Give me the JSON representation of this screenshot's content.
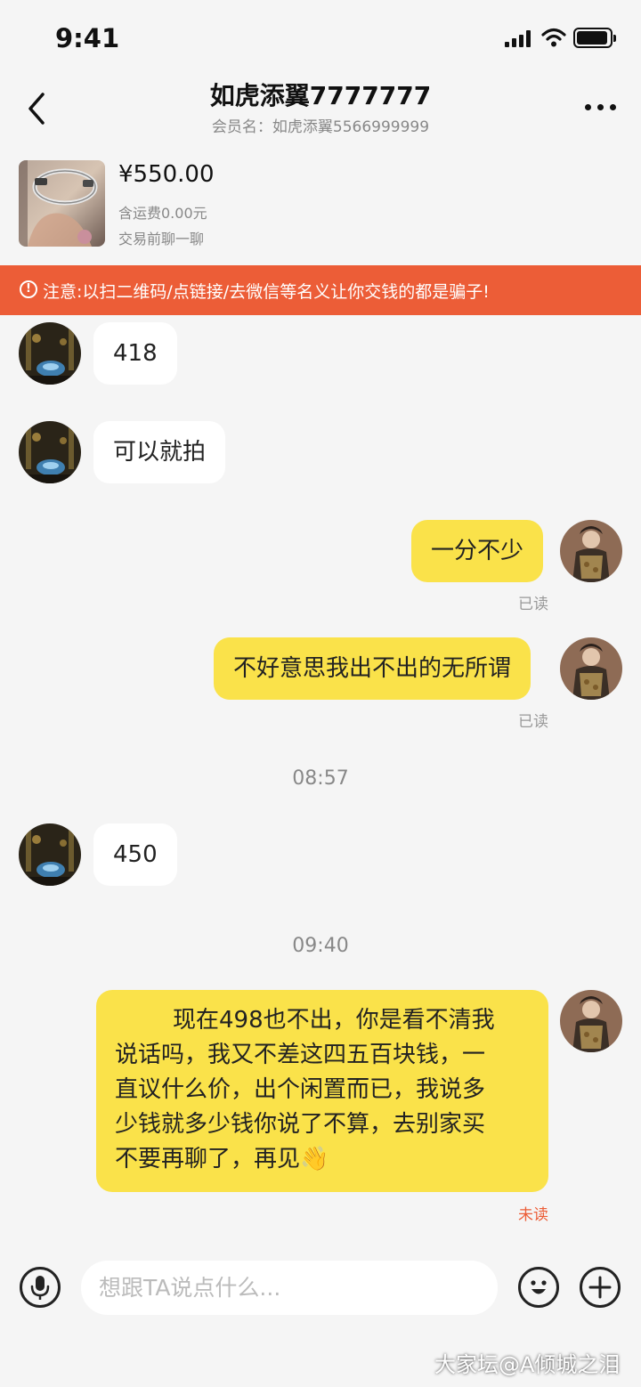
{
  "status_bar": {
    "time": "9:41"
  },
  "header": {
    "title": "如虎添翼7777777",
    "subtitle": "会员名：如虎添翼5566999999"
  },
  "product": {
    "price": "¥550.00",
    "shipping": "含运费0.00元",
    "chat_before_deal": "交易前聊一聊"
  },
  "warning": {
    "text": "注意:以扫二维码/点链接/去微信等名义让你交钱的都是骗子!",
    "icon_glyph": "!"
  },
  "messages": {
    "m1": {
      "text": "418"
    },
    "m2": {
      "text": "可以就拍"
    },
    "m3": {
      "text": "一分不少",
      "status": "已读"
    },
    "m4": {
      "text": "不好意思我出不出的无所谓",
      "status": "已读"
    },
    "t1": "08:57",
    "m5": {
      "text": "450"
    },
    "t2": "09:40",
    "m6": {
      "lines": [
        "现在498也不出，你是看不清我",
        "说话吗，我又不差这四五百块钱，一",
        "直议什么价，出个闲置而已，我说多",
        "少钱就多少钱你说了不算，去别家买",
        "不要再聊了，再见"
      ],
      "emoji": "👋",
      "status": "未读"
    }
  },
  "input_bar": {
    "placeholder": "想跟TA说点什么..."
  },
  "watermark": "大家坛@A倾城之泪",
  "colors": {
    "accent_orange": "#ec5d37",
    "own_bubble": "#fae24a",
    "background": "#f5f5f5"
  },
  "icons": [
    "signal-icon",
    "wifi-icon",
    "battery-icon",
    "back-arrow-icon",
    "more-icon",
    "alert-icon",
    "microphone-icon",
    "emoji-icon",
    "plus-icon"
  ]
}
